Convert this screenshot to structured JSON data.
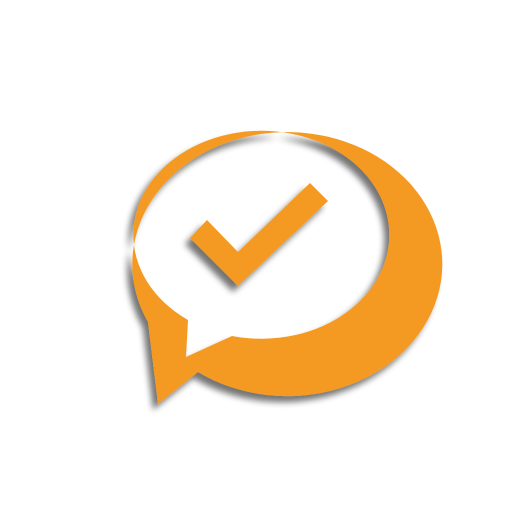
{
  "icon": {
    "name": "chat-bubble-checkmark-icon",
    "glyph_outer": "speech-bubble",
    "glyph_inner": "checkmark"
  },
  "colors": {
    "background": "#ffffff",
    "accent": "#F49A20",
    "shadow": "#000000"
  }
}
